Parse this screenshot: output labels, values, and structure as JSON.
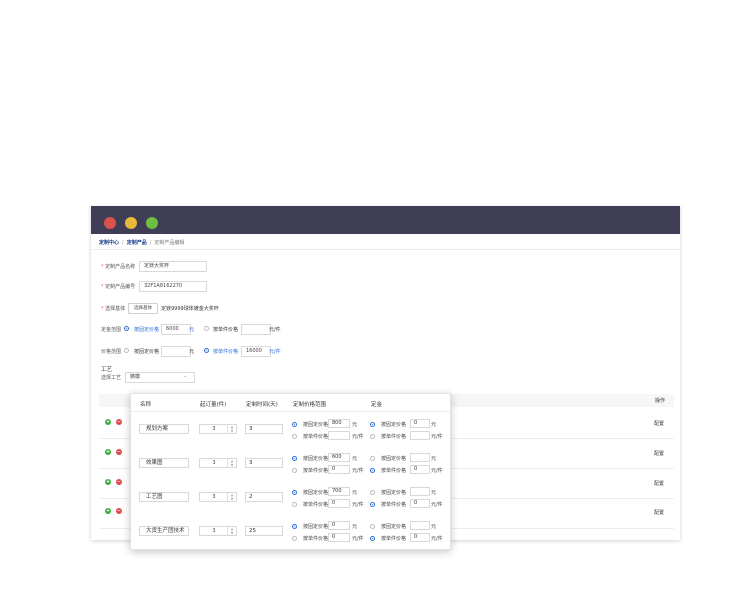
{
  "breadcrumb": [
    "定制中心",
    "定制产品",
    "定制产品编辑"
  ],
  "form": {
    "name_label": "定制产品名称",
    "name_value": "定镁大奖杯",
    "code_label": "定制产品编号",
    "code_value": "32F1A8162270",
    "base_label": "选择基体",
    "base_button": "选择基体",
    "base_value": "定镁9999球体镀金大奖杯",
    "fixed_label": "定金范围",
    "fixed_opt1": "按固定价格",
    "fixed_val1": "6000",
    "fixed_unit1": "元",
    "fixed_opt2": "按单件价格",
    "fixed_val2": "",
    "fixed_unit2": "元/件",
    "price_label": "价格范围",
    "price_opt1": "按固定价格",
    "price_val1": "",
    "price_unit1": "元",
    "price_opt2": "按单件价格",
    "price_val2": "16000",
    "price_unit2": "元/件",
    "craft_title": "工艺",
    "craft_select_label": "选择工艺",
    "craft_select_value": "铸模"
  },
  "table": {
    "op_header": "操作",
    "rows": [
      {
        "action": "配置"
      },
      {
        "action": "配置"
      },
      {
        "action": "配置"
      },
      {
        "action": "配置"
      }
    ]
  },
  "popup": {
    "headers": [
      "名称",
      "起订量(件)",
      "定制时间(天)",
      "定制价格范围",
      "定金"
    ],
    "rows": [
      {
        "name": "规划方案",
        "qty": "3",
        "days": "3",
        "p1_label": "按固定价格",
        "p1_val": "800",
        "p1_unit": "元",
        "p2_label": "按单件价格",
        "p2_val": "",
        "p2_unit": "元/件",
        "d1_label": "按固定价格",
        "d1_val": "0",
        "d1_unit": "元",
        "d2_label": "按单件价格",
        "d2_val": "",
        "d2_unit": "元/件",
        "price_sel": 1,
        "dep_sel": 1
      },
      {
        "name": "效果图",
        "qty": "3",
        "days": "3",
        "p1_label": "按固定价格",
        "p1_val": "600",
        "p1_unit": "元",
        "p2_label": "按单件价格",
        "p2_val": "0",
        "p2_unit": "元/件",
        "d1_label": "按固定价格",
        "d1_val": "",
        "d1_unit": "元",
        "d2_label": "按单件价格",
        "d2_val": "0",
        "d2_unit": "元/件",
        "price_sel": 1,
        "dep_sel": 2
      },
      {
        "name": "工艺图",
        "qty": "3",
        "days": "2",
        "p1_label": "按固定价格",
        "p1_val": "700",
        "p1_unit": "元",
        "p2_label": "按单件价格",
        "p2_val": "0",
        "p2_unit": "元/件",
        "d1_label": "按固定价格",
        "d1_val": "",
        "d1_unit": "元",
        "d2_label": "按单件价格",
        "d2_val": "0",
        "d2_unit": "元/件",
        "price_sel": 1,
        "dep_sel": 2
      },
      {
        "name": "大货生产团技术",
        "qty": "3",
        "days": "25",
        "p1_label": "按固定价格",
        "p1_val": "0",
        "p1_unit": "元",
        "p2_label": "按单件价格",
        "p2_val": "0",
        "p2_unit": "元/件",
        "d1_label": "按固定价格",
        "d1_val": "",
        "d1_unit": "元",
        "d2_label": "按单件价格",
        "d2_val": "0",
        "d2_unit": "元/件",
        "price_sel": 1,
        "dep_sel": 2
      }
    ]
  },
  "colors": {
    "titlebar": "#403e57",
    "accent": "#2f6fd6",
    "close": "#d9524e",
    "minimize": "#e8b93a",
    "maximize": "#6cbf43"
  }
}
